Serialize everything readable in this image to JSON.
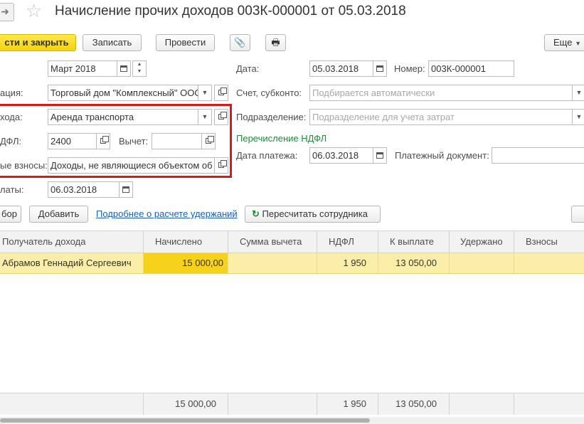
{
  "window": {
    "title": "Начисление прочих доходов 003К-000001 от 05.03.2018"
  },
  "toolbar": {
    "post_close": "сти и закрыть",
    "save": "Записать",
    "post": "Провести",
    "more": "Еще"
  },
  "form": {
    "period_value": "Март 2018",
    "org_label": "ация:",
    "org_value": "Торговый дом \"Комплексный\" ООО",
    "income_label": "хода:",
    "income_value": "Аренда транспорта",
    "ndfl_label": "ДФЛ:",
    "ndfl_value": "2400",
    "deduction_label": "Вычет:",
    "deduction_value": "",
    "contrib_label": "ые взносы:",
    "contrib_value": "Доходы, не являющиеся объектом об",
    "paydate_label": "латы:",
    "paydate_value": "06.03.2018",
    "date_label": "Дата:",
    "date_value": "05.03.2018",
    "number_label": "Номер:",
    "number_value": "003К-000001",
    "account_label": "Счет, субконто:",
    "account_placeholder": "Подбирается автоматически",
    "dept_label": "Подразделение:",
    "dept_placeholder": "Подразделение для учета затрат",
    "ndfl_transfer": "Перечисление НДФЛ",
    "payment_date_label": "Дата платежа:",
    "payment_date_value": "06.03.2018",
    "payment_doc_label": "Платежный документ:"
  },
  "table_toolbar": {
    "select": "бор",
    "add": "Добавить",
    "details_link": "Подробнее о расчете удержаний",
    "recalc": "Пересчитать сотрудника"
  },
  "table": {
    "columns": [
      "Получатель дохода",
      "Начислено",
      "Сумма вычета",
      "НДФЛ",
      "К выплате",
      "Удержано",
      "Взносы"
    ],
    "rows": [
      {
        "recipient": "Абрамов Геннадий Сергеевич",
        "accrued": "15 000,00",
        "deduction": "",
        "ndfl": "1 950",
        "payout": "13 050,00",
        "withheld": "",
        "contrib": ""
      }
    ],
    "totals": {
      "accrued": "15 000,00",
      "ndfl": "1 950",
      "payout": "13 050,00"
    }
  },
  "colors": {
    "accent_yellow": "#f5d20e",
    "highlight_red": "#d21b1b",
    "row_selected": "#fbeea9"
  }
}
